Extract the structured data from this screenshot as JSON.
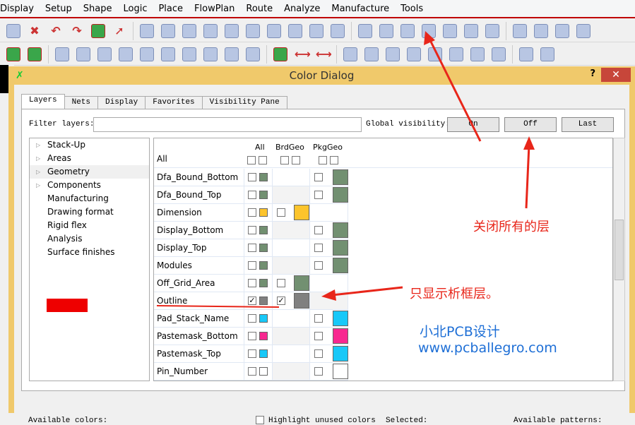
{
  "menu": [
    "Display",
    "Setup",
    "Shape",
    "Logic",
    "Place",
    "FlowPlan",
    "Route",
    "Analyze",
    "Manufacture",
    "Tools"
  ],
  "dialog": {
    "title": "Color Dialog",
    "help": "?",
    "close": "✕"
  },
  "tabs": [
    "Layers",
    "Nets",
    "Display",
    "Favorites",
    "Visibility Pane"
  ],
  "filter": {
    "label": "Filter layers:",
    "value": ""
  },
  "global_visibility": {
    "label": "Global visibility:",
    "on": "On",
    "off": "Off",
    "last": "Last"
  },
  "tree": [
    {
      "label": "Stack-Up",
      "expandable": true
    },
    {
      "label": "Areas",
      "expandable": true
    },
    {
      "label": "Geometry",
      "expandable": true,
      "selected": true
    },
    {
      "label": "Components",
      "expandable": true
    },
    {
      "label": "Manufacturing"
    },
    {
      "label": "Drawing format"
    },
    {
      "label": "Rigid flex"
    },
    {
      "label": "Analysis"
    },
    {
      "label": "Surface finishes"
    }
  ],
  "grid": {
    "headers": {
      "all": "All",
      "brd": "BrdGeo",
      "pkg": "PkgGeo",
      "all_row": "All"
    },
    "rows": [
      {
        "name": "Dfa_Bound_Bottom",
        "col": "pkg",
        "color": "#729071",
        "checked": false
      },
      {
        "name": "Dfa_Bound_Top",
        "col": "pkg",
        "color": "#729071",
        "checked": false
      },
      {
        "name": "Dimension",
        "col": "brd",
        "color": "#fcc42c",
        "checked": false
      },
      {
        "name": "Display_Bottom",
        "col": "pkg",
        "color": "#729071",
        "checked": false
      },
      {
        "name": "Display_Top",
        "col": "pkg",
        "color": "#729071",
        "checked": false
      },
      {
        "name": "Modules",
        "col": "pkg",
        "color": "#729071",
        "checked": false
      },
      {
        "name": "Off_Grid_Area",
        "col": "brd",
        "color": "#729071",
        "checked": false
      },
      {
        "name": "Outline",
        "col": "brd",
        "color": "#808080",
        "checked": true
      },
      {
        "name": "Pad_Stack_Name",
        "col": "pkg",
        "color": "#18c8f8",
        "checked": false
      },
      {
        "name": "Pastemask_Bottom",
        "col": "pkg",
        "color": "#f82890",
        "checked": false
      },
      {
        "name": "Pastemask_Top",
        "col": "pkg",
        "color": "#18c8f8",
        "checked": false
      },
      {
        "name": "Pin_Number",
        "col": "pkg",
        "color": "#ffffff",
        "checked": false
      }
    ]
  },
  "bottom": {
    "available_colors": "Available colors:",
    "highlight": "Highlight unused colors",
    "selected": "Selected:",
    "patterns": "Available patterns:"
  },
  "annotations": {
    "off_all": "关闭所有的层",
    "outline_only": "只显示析框层。",
    "wm1": "小北PCB设计",
    "wm2": "www.pcballegro.com"
  },
  "colors": {
    "accent": "#e8261a",
    "dialog_title": "#f0c96b"
  }
}
